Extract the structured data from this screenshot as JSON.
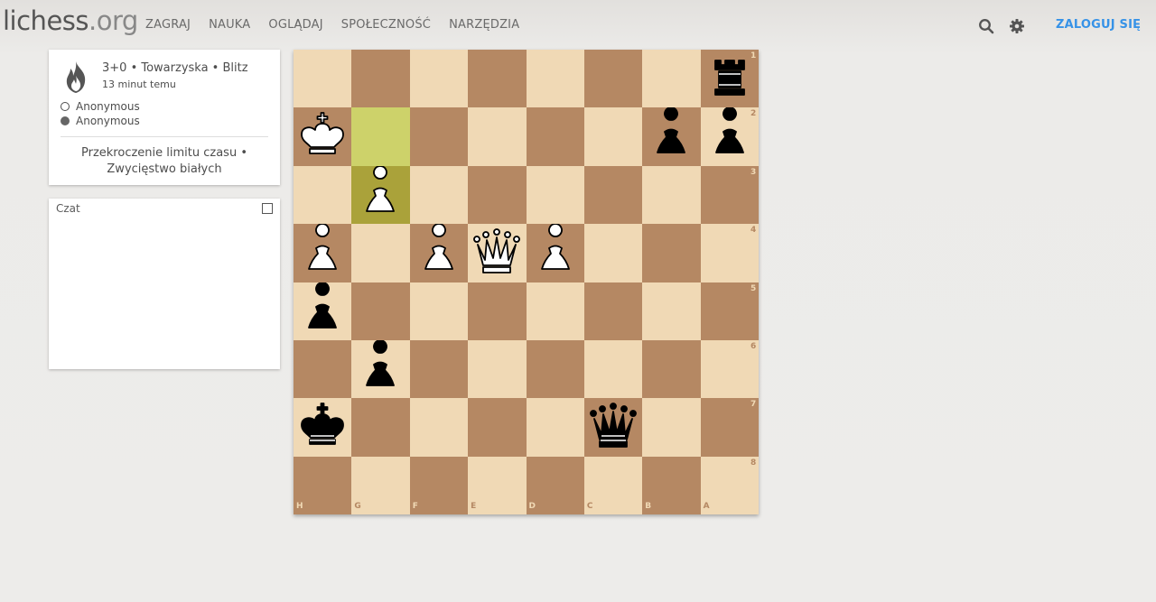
{
  "header": {
    "logo_main": "lichess",
    "logo_tld": ".org",
    "nav": [
      "ZAGRAJ",
      "NAUKA",
      "OGLĄDAJ",
      "SPOŁECZNOŚĆ",
      "NARZĘDZIA"
    ],
    "login_label": "ZALOGUJ SIĘ",
    "search_icon": "search-icon",
    "settings_icon": "gear-icon"
  },
  "game_info": {
    "mode_icon": "flame-icon",
    "meta": "3+0 • Towarzyska • Blitz",
    "time_ago": "13 minut temu",
    "white_player": "Anonymous",
    "black_player": "Anonymous",
    "result_line1": "Przekroczenie limitu czasu •",
    "result_line2": "Zwycięstwo białych"
  },
  "chat": {
    "title": "Czat"
  },
  "board": {
    "orientation": "black",
    "files_left_to_right": [
      "H",
      "G",
      "F",
      "E",
      "D",
      "C",
      "B",
      "A"
    ],
    "ranks_top_to_bottom": [
      "1",
      "2",
      "3",
      "4",
      "5",
      "6",
      "7",
      "8"
    ],
    "last_move_highlight": [
      "g2",
      "g3"
    ],
    "highlight_colors": {
      "from": "#cdd26a",
      "to": "#aaa23a"
    },
    "square_colors": {
      "light": "#f0d9b5",
      "dark": "#b58863"
    },
    "pieces": [
      {
        "square": "a1",
        "piece": "rook",
        "color": "black"
      },
      {
        "square": "h2",
        "piece": "king",
        "color": "white"
      },
      {
        "square": "b2",
        "piece": "pawn",
        "color": "black"
      },
      {
        "square": "a2",
        "piece": "pawn",
        "color": "black"
      },
      {
        "square": "g3",
        "piece": "pawn",
        "color": "white"
      },
      {
        "square": "h4",
        "piece": "pawn",
        "color": "white"
      },
      {
        "square": "f4",
        "piece": "pawn",
        "color": "white"
      },
      {
        "square": "e4",
        "piece": "queen",
        "color": "white"
      },
      {
        "square": "d4",
        "piece": "pawn",
        "color": "white"
      },
      {
        "square": "h5",
        "piece": "pawn",
        "color": "black"
      },
      {
        "square": "g6",
        "piece": "pawn",
        "color": "black"
      },
      {
        "square": "h7",
        "piece": "king",
        "color": "black"
      },
      {
        "square": "c7",
        "piece": "queen",
        "color": "black"
      }
    ]
  }
}
